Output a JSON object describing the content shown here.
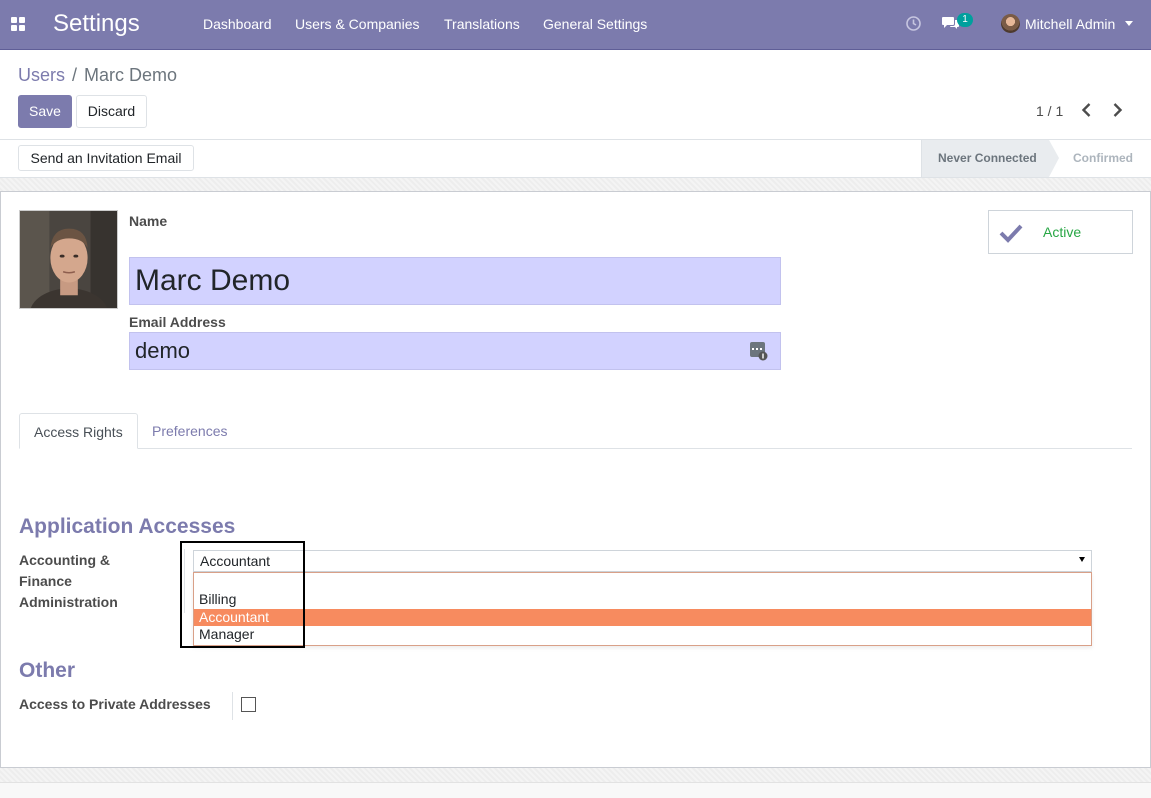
{
  "navbar": {
    "app_title": "Settings",
    "menu": [
      "Dashboard",
      "Users & Companies",
      "Translations",
      "General Settings"
    ],
    "chat_count": "1",
    "user_name": "Mitchell Admin",
    "color": "#7c7bad"
  },
  "breadcrumb": {
    "parent": "Users",
    "separator": "/",
    "current": "Marc Demo"
  },
  "buttons": {
    "save": "Save",
    "discard": "Discard",
    "invite": "Send an Invitation Email"
  },
  "pager": {
    "value": "1 / 1"
  },
  "status": {
    "stages": [
      "Never Connected",
      "Confirmed"
    ],
    "current": "Never Connected"
  },
  "form": {
    "name_label": "Name",
    "name_value": "Marc Demo",
    "email_label": "Email Address",
    "email_value": "demo",
    "active_label": "Active"
  },
  "tabs": [
    "Access Rights",
    "Preferences"
  ],
  "access": {
    "section_title": "Application Accesses",
    "accounting_label": [
      "Accounting &",
      "Finance",
      "Administration"
    ],
    "accounting_value": "Accountant",
    "options": [
      "",
      "Billing",
      "Accountant",
      "Manager"
    ],
    "selected_option": "Accountant",
    "other_title": "Other",
    "private_addresses_label": "Access to Private Addresses",
    "private_addresses_checked": false
  }
}
